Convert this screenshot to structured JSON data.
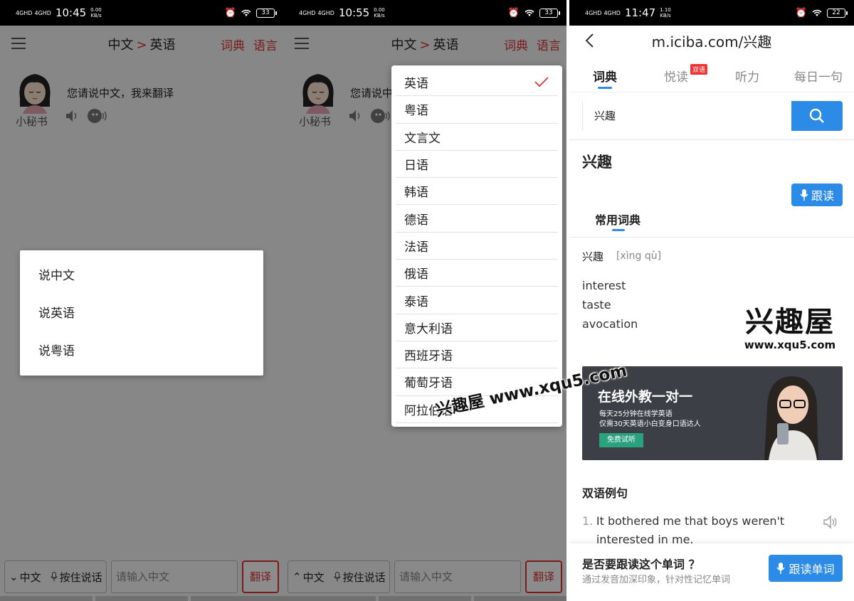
{
  "screen1": {
    "status": {
      "net": [
        "4GHD",
        "4GHD"
      ],
      "time": "10:45",
      "speed_value": "0.00",
      "speed_unit": "KB/s",
      "battery": "33"
    },
    "header": {
      "from_lang": "中文",
      "arrow": ">",
      "to_lang": "英语",
      "link_dict": "词典",
      "link_lang": "语言"
    },
    "assistant": {
      "name": "小秘书",
      "prompt": "您请说中文，我来翻译"
    },
    "dialog_options": [
      "说中文",
      "说英语",
      "说粤语"
    ],
    "input_bar": {
      "lang_label": "中文",
      "voice_label": "按住说话",
      "input_placeholder": "请输入中文",
      "translate_label": "翻译"
    }
  },
  "screen2": {
    "status": {
      "net": [
        "4GHD",
        "4GHD"
      ],
      "time": "10:55",
      "speed_value": "0.00",
      "speed_unit": "KB/s",
      "battery": "33"
    },
    "header": {
      "from_lang": "中文",
      "arrow": ">",
      "to_lang": "英语",
      "link_dict": "词典",
      "link_lang": "语言"
    },
    "assistant": {
      "name": "小秘书",
      "prompt": "您请说中文，我来翻译"
    },
    "languages": [
      "英语",
      "粤语",
      "文言文",
      "日语",
      "韩语",
      "德语",
      "法语",
      "俄语",
      "泰语",
      "意大利语",
      "西班牙语",
      "葡萄牙语",
      "阿拉伯语"
    ],
    "selected_language": "英语",
    "input_bar": {
      "lang_label": "中文",
      "voice_label": "按住说话",
      "input_placeholder": "请输入中文",
      "translate_label": "翻译"
    }
  },
  "screen3": {
    "status": {
      "net": [
        "4GHD",
        "4GHD"
      ],
      "time": "11:47",
      "speed_value": "1.10",
      "speed_unit": "KB/s",
      "battery": "22"
    },
    "browser_title": "m.iciba.com/兴趣",
    "tabs": [
      {
        "label": "词典"
      },
      {
        "label": "悦读",
        "badge": "双语"
      },
      {
        "label": "听力"
      },
      {
        "label": "每日一句"
      }
    ],
    "search_value": "兴趣",
    "word": "兴趣",
    "follow_read_label": "跟读",
    "dict_section": "常用词典",
    "entry": {
      "word": "兴趣",
      "pinyin": "[xìng qù]"
    },
    "meanings": [
      "interest",
      "taste",
      "avocation"
    ],
    "ad": {
      "title": "在线外教一对一",
      "line1": "每天25分钟在线学英语",
      "line2": "仅需30天英语小白变身口语达人",
      "button": "免费试听"
    },
    "examples_title": "双语例句",
    "example": {
      "num": "1.",
      "text": "It bothered me that boys weren't interested in me."
    },
    "prompt": {
      "question": "是否要跟读这个单词 ？",
      "sub": "通过发音加深印象，针对性记忆单词",
      "button": "跟读单词"
    }
  },
  "watermark": {
    "title": "兴趣屋",
    "url": "www.xqu5.com",
    "diagonal": "兴趣屋 www.xqu5.com"
  },
  "colors": {
    "accent_red": "#d33333",
    "accent_blue": "#2b8be6"
  }
}
